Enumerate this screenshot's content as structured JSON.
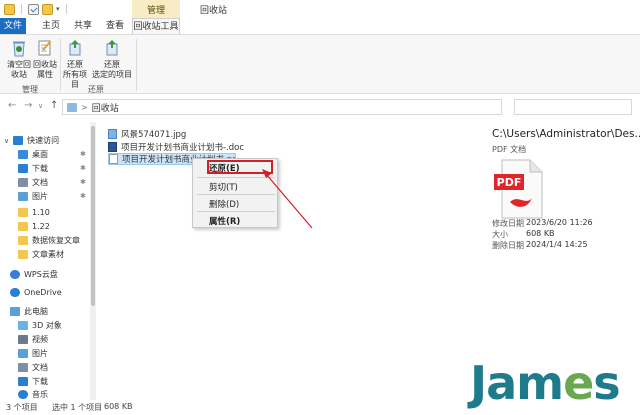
{
  "titlebar": {
    "context_label": "管理",
    "window_title": "回收站"
  },
  "tabs": [
    {
      "label": "文件"
    },
    {
      "label": "主页"
    },
    {
      "label": "共享"
    },
    {
      "label": "查看"
    },
    {
      "label": "回收站工具"
    }
  ],
  "ribbon": {
    "buttons": [
      {
        "label": "清空回\n收站",
        "icon": "empty-recycle-bin-icon"
      },
      {
        "label": "回收站\n属性",
        "icon": "recycle-bin-properties-icon"
      },
      {
        "label": "还原\n所有项目",
        "icon": "restore-all-icon"
      },
      {
        "label": "还原\n选定的项目",
        "icon": "restore-selected-icon"
      }
    ],
    "groups": [
      {
        "label": "管理"
      },
      {
        "label": "还原"
      }
    ]
  },
  "address": {
    "location": "回收站",
    "separator": ">"
  },
  "nav": {
    "items": [
      {
        "label": "快速访问",
        "color": "#2a7fd0"
      },
      {
        "label": "桌面",
        "color": "#3b8ad9",
        "pinned": true
      },
      {
        "label": "下载",
        "color": "#2a7fd0",
        "pinned": true
      },
      {
        "label": "文档",
        "color": "#7f8fa6",
        "pinned": true
      },
      {
        "label": "图片",
        "color": "#5aa0d8",
        "pinned": true
      },
      {
        "label": "1.10",
        "color": "#f3c64d"
      },
      {
        "label": "1.22",
        "color": "#f3c64d"
      },
      {
        "label": "数据恢复文章",
        "color": "#f3c64d"
      },
      {
        "label": "文章素材",
        "color": "#f3c64d"
      },
      {
        "label": "WPS云盘",
        "color": "#3a7bd5"
      },
      {
        "label": "OneDrive",
        "color": "#2a7fd0"
      },
      {
        "label": "此电脑",
        "color": "#5aa0d8"
      },
      {
        "label": "3D 对象",
        "color": "#6bb1e6"
      },
      {
        "label": "视频",
        "color": "#6d7a8a"
      },
      {
        "label": "图片",
        "color": "#5aa0d8"
      },
      {
        "label": "文档",
        "color": "#7f8fa6"
      },
      {
        "label": "下载",
        "color": "#2a7fd0"
      },
      {
        "label": "音乐",
        "color": "#2a7fd0"
      }
    ]
  },
  "files": [
    {
      "name": "风景574071.jpg"
    },
    {
      "name": "项目开发计划书商业计划书-.doc"
    },
    {
      "name": "项目开发计划书商业计划书.pdf"
    }
  ],
  "context_menu": {
    "items": [
      {
        "label": "还原(E)"
      },
      {
        "label": "剪切(T)"
      },
      {
        "label": "删除(D)"
      },
      {
        "label": "属性(R)"
      }
    ]
  },
  "details": {
    "path": "C:\\Users\\Administrator\\Des...",
    "type": "PDF 文档",
    "properties": [
      {
        "key": "修改日期",
        "value": "2023/6/20 11:26"
      },
      {
        "key": "大小",
        "value": "608 KB"
      },
      {
        "key": "删除日期",
        "value": "2024/1/4 14:25"
      }
    ]
  },
  "status": {
    "count": "3 个项目",
    "selected": "选中 1 个项目",
    "size": "608 KB"
  },
  "watermark": {
    "text_a": "Jam",
    "text_b": "e",
    "text_c": "s"
  },
  "colors": {
    "accent": "#1b6ec2",
    "highlight": "#d0202c",
    "selection": "#cce4f7"
  }
}
